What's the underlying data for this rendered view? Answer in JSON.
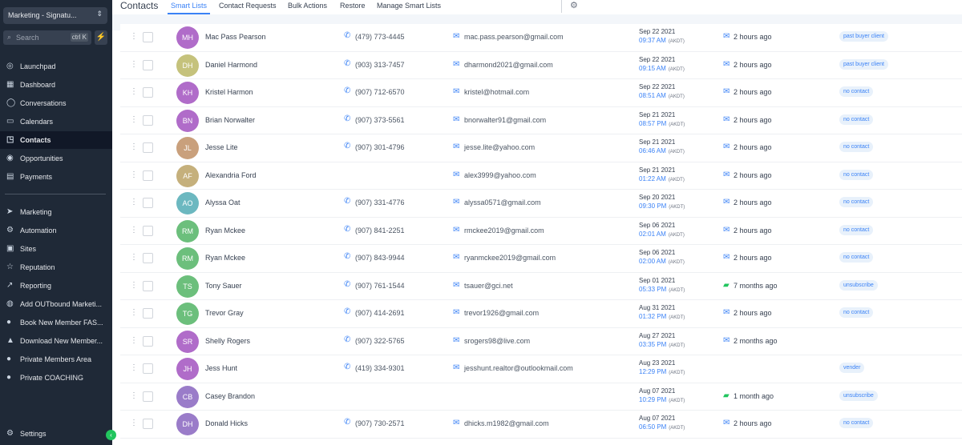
{
  "sidebar": {
    "account": "Marketing - Signatu...",
    "search": {
      "placeholder": "Search",
      "shortcut": "ctrl K"
    },
    "items": [
      {
        "label": "Launchpad",
        "icon": "rocket-icon",
        "glyph": "◎"
      },
      {
        "label": "Dashboard",
        "icon": "dashboard-icon",
        "glyph": "▦"
      },
      {
        "label": "Conversations",
        "icon": "chat-icon",
        "glyph": "◯"
      },
      {
        "label": "Calendars",
        "icon": "calendar-icon",
        "glyph": "▭"
      },
      {
        "label": "Contacts",
        "icon": "contacts-icon",
        "glyph": "◳"
      },
      {
        "label": "Opportunities",
        "icon": "opportunities-icon",
        "glyph": "◉"
      },
      {
        "label": "Payments",
        "icon": "payments-icon",
        "glyph": "▤"
      },
      {
        "label": "Marketing",
        "icon": "send-icon",
        "glyph": "➤"
      },
      {
        "label": "Automation",
        "icon": "automation-icon",
        "glyph": "⚙"
      },
      {
        "label": "Sites",
        "icon": "sites-icon",
        "glyph": "▣"
      },
      {
        "label": "Reputation",
        "icon": "star-icon",
        "glyph": "☆"
      },
      {
        "label": "Reporting",
        "icon": "chart-icon",
        "glyph": "↗"
      },
      {
        "label": "Add OUTbound Marketi...",
        "icon": "globe-icon",
        "glyph": "◍"
      },
      {
        "label": "Book New Member FAS...",
        "icon": "users-icon",
        "glyph": "●"
      },
      {
        "label": "Download New Member...",
        "icon": "graduation-icon",
        "glyph": "▲"
      },
      {
        "label": "Private Members Area",
        "icon": "users-icon",
        "glyph": "●"
      },
      {
        "label": "Private COACHING",
        "icon": "user-icon",
        "glyph": "●"
      }
    ],
    "settings": "Settings"
  },
  "header": {
    "title": "Contacts",
    "tabs": [
      "Smart Lists",
      "Contact Requests",
      "Bulk Actions",
      "Restore",
      "Manage Smart Lists"
    ]
  },
  "colors": {
    "accent": "#3b82f6",
    "sidebar_bg": "#1f2937",
    "tag_bg": "#e8f1fb"
  },
  "contacts": [
    {
      "initials": "MH",
      "color": "#b06cc9",
      "name": "Mac Pass Pearson",
      "phone": "(479) 773-4445",
      "email": "mac.pass.pearson@gmail.com",
      "date": "Sep 22 2021",
      "time": "09:37 AM",
      "tz": "(AKDT)",
      "activity": "2 hours ago",
      "channel": "email",
      "tag": "past buyer client"
    },
    {
      "initials": "DH",
      "color": "#c5c27c",
      "name": "Daniel Harmond",
      "phone": "(903) 313-7457",
      "email": "dharmond2021@gmail.com",
      "date": "Sep 22 2021",
      "time": "09:15 AM",
      "tz": "(AKDT)",
      "activity": "2 hours ago",
      "channel": "email",
      "tag": "past buyer client"
    },
    {
      "initials": "KH",
      "color": "#b06cc9",
      "name": "Kristel Harmon",
      "phone": "(907) 712-6570",
      "email": "kristel@hotmail.com",
      "date": "Sep 22 2021",
      "time": "08:51 AM",
      "tz": "(AKDT)",
      "activity": "2 hours ago",
      "channel": "email",
      "tag": "no contact"
    },
    {
      "initials": "BN",
      "color": "#b06cc9",
      "name": "Brian Norwalter",
      "phone": "(907) 373-5561",
      "email": "bnorwalter91@gmail.com",
      "date": "Sep 21 2021",
      "time": "08:57 PM",
      "tz": "(AKDT)",
      "activity": "2 hours ago",
      "channel": "email",
      "tag": "no contact"
    },
    {
      "initials": "JL",
      "color": "#c9a07c",
      "name": "Jesse Lite",
      "phone": "(907) 301-4796",
      "email": "jesse.lite@yahoo.com",
      "date": "Sep 21 2021",
      "time": "06:46 AM",
      "tz": "(AKDT)",
      "activity": "2 hours ago",
      "channel": "email",
      "tag": "no contact"
    },
    {
      "initials": "AF",
      "color": "#c5b07c",
      "name": "Alexandria Ford",
      "phone": "",
      "email": "alex3999@yahoo.com",
      "date": "Sep 21 2021",
      "time": "01:22 AM",
      "tz": "(AKDT)",
      "activity": "2 hours ago",
      "channel": "email",
      "tag": "no contact"
    },
    {
      "initials": "AO",
      "color": "#6cb8c0",
      "name": "Alyssa Oat",
      "phone": "(907) 331-4776",
      "email": "alyssa0571@gmail.com",
      "date": "Sep 20 2021",
      "time": "09:30 PM",
      "tz": "(AKDT)",
      "activity": "2 hours ago",
      "channel": "email",
      "tag": "no contact"
    },
    {
      "initials": "RM",
      "color": "#6cbf7c",
      "name": "Ryan Mckee",
      "phone": "(907) 841-2251",
      "email": "rmckee2019@gmail.com",
      "date": "Sep 06 2021",
      "time": "02:01 AM",
      "tz": "(AKDT)",
      "activity": "2 hours ago",
      "channel": "email",
      "tag": "no contact"
    },
    {
      "initials": "RM",
      "color": "#6cbf7c",
      "name": "Ryan Mckee",
      "phone": "(907) 843-9944",
      "email": "ryanmckee2019@gmail.com",
      "date": "Sep 06 2021",
      "time": "02:00 AM",
      "tz": "(AKDT)",
      "activity": "2 hours ago",
      "channel": "email",
      "tag": "no contact"
    },
    {
      "initials": "TS",
      "color": "#6cbf7c",
      "name": "Tony Sauer",
      "phone": "(907) 761-1544",
      "email": "tsauer@gci.net",
      "date": "Sep 01 2021",
      "time": "05:33 PM",
      "tz": "(AKDT)",
      "activity": "7 months ago",
      "channel": "sms",
      "tag": "unsubscribe"
    },
    {
      "initials": "TG",
      "color": "#6cbf7c",
      "name": "Trevor Gray",
      "phone": "(907) 414-2691",
      "email": "trevor1926@gmail.com",
      "date": "Aug 31 2021",
      "time": "01:32 PM",
      "tz": "(AKDT)",
      "activity": "2 hours ago",
      "channel": "email",
      "tag": "no contact"
    },
    {
      "initials": "SR",
      "color": "#b06cc9",
      "name": "Shelly Rogers",
      "phone": "(907) 322-5765",
      "email": "srogers98@live.com",
      "date": "Aug 27 2021",
      "time": "03:35 PM",
      "tz": "(AKDT)",
      "activity": "2 months ago",
      "channel": "email",
      "tag": ""
    },
    {
      "initials": "JH",
      "color": "#b06cc9",
      "name": "Jess Hunt",
      "phone": "(419) 334-9301",
      "email": "jesshunt.realtor@outlookmail.com",
      "date": "Aug 23 2021",
      "time": "12:29 PM",
      "tz": "(AKDT)",
      "activity": "",
      "channel": "",
      "tag": "vender"
    },
    {
      "initials": "CB",
      "color": "#9a7cc9",
      "name": "Casey Brandon",
      "phone": "",
      "email": "",
      "date": "Aug 07 2021",
      "time": "10:29 PM",
      "tz": "(AKDT)",
      "activity": "1 month ago",
      "channel": "sms",
      "tag": "unsubscribe"
    },
    {
      "initials": "DH",
      "color": "#9a7cc9",
      "name": "Donald Hicks",
      "phone": "(907) 730-2571",
      "email": "dhicks.m1982@gmail.com",
      "date": "Aug 07 2021",
      "time": "06:50 PM",
      "tz": "(AKDT)",
      "activity": "2 hours ago",
      "channel": "email",
      "tag": "no contact"
    }
  ]
}
